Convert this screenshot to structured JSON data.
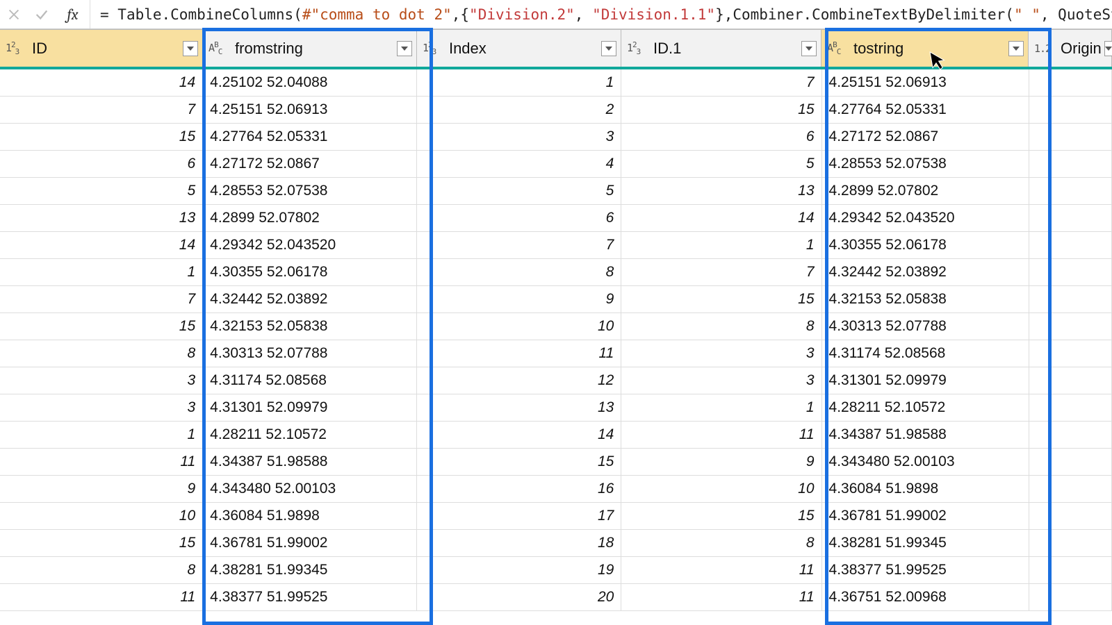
{
  "formula_bar": {
    "fx_label": "fx",
    "formula_prefix": "= ",
    "formula_fn1": "Table.CombineColumns(",
    "formula_str1": "#\"comma to dot 2\"",
    "formula_mid1": ",{",
    "formula_str2a": "\"Division.2\"",
    "formula_mid2": ", ",
    "formula_str2b": "\"Division.1.1\"",
    "formula_mid3": "},Combiner.CombineTextByDelimiter(",
    "formula_str3": "\" \"",
    "formula_tail": ", QuoteSt"
  },
  "columns": [
    {
      "type": "num",
      "icon": "1²₃",
      "name": "ID",
      "width": "w-id",
      "selected": true,
      "align": "num"
    },
    {
      "type": "text",
      "icon": "AᴮC",
      "name": "fromstring",
      "width": "w-from",
      "selected": false,
      "align": "txt",
      "highlighted": true
    },
    {
      "type": "num",
      "icon": "1²₃",
      "name": "Index",
      "width": "w-idx",
      "selected": false,
      "align": "num"
    },
    {
      "type": "num",
      "icon": "1²₃",
      "name": "ID.1",
      "width": "w-id1",
      "selected": false,
      "align": "num"
    },
    {
      "type": "text",
      "icon": "AᴮC",
      "name": "tostring",
      "width": "w-to",
      "selected": true,
      "align": "txt",
      "highlighted": true
    },
    {
      "type": "dec",
      "icon": "1.2",
      "name": "Origin",
      "width": "w-orig",
      "selected": false,
      "align": "num"
    }
  ],
  "rows": [
    {
      "id": "14",
      "from": "4.25102 52.04088",
      "idx": "1",
      "id1": "7",
      "to": "4.25151 52.06913"
    },
    {
      "id": "7",
      "from": "4.25151 52.06913",
      "idx": "2",
      "id1": "15",
      "to": "4.27764 52.05331"
    },
    {
      "id": "15",
      "from": "4.27764 52.05331",
      "idx": "3",
      "id1": "6",
      "to": "4.27172 52.0867"
    },
    {
      "id": "6",
      "from": "4.27172 52.0867",
      "idx": "4",
      "id1": "5",
      "to": "4.28553 52.07538"
    },
    {
      "id": "5",
      "from": "4.28553 52.07538",
      "idx": "5",
      "id1": "13",
      "to": "4.2899 52.07802"
    },
    {
      "id": "13",
      "from": "4.2899 52.07802",
      "idx": "6",
      "id1": "14",
      "to": "4.29342 52.043520"
    },
    {
      "id": "14",
      "from": "4.29342 52.043520",
      "idx": "7",
      "id1": "1",
      "to": "4.30355 52.06178"
    },
    {
      "id": "1",
      "from": "4.30355 52.06178",
      "idx": "8",
      "id1": "7",
      "to": "4.32442 52.03892"
    },
    {
      "id": "7",
      "from": "4.32442 52.03892",
      "idx": "9",
      "id1": "15",
      "to": "4.32153 52.05838"
    },
    {
      "id": "15",
      "from": "4.32153 52.05838",
      "idx": "10",
      "id1": "8",
      "to": "4.30313 52.07788"
    },
    {
      "id": "8",
      "from": "4.30313 52.07788",
      "idx": "11",
      "id1": "3",
      "to": "4.31174 52.08568"
    },
    {
      "id": "3",
      "from": "4.31174 52.08568",
      "idx": "12",
      "id1": "3",
      "to": "4.31301 52.09979"
    },
    {
      "id": "3",
      "from": "4.31301 52.09979",
      "idx": "13",
      "id1": "1",
      "to": "4.28211 52.10572"
    },
    {
      "id": "1",
      "from": "4.28211 52.10572",
      "idx": "14",
      "id1": "11",
      "to": "4.34387 51.98588"
    },
    {
      "id": "11",
      "from": "4.34387 51.98588",
      "idx": "15",
      "id1": "9",
      "to": "4.343480 52.00103"
    },
    {
      "id": "9",
      "from": "4.343480 52.00103",
      "idx": "16",
      "id1": "10",
      "to": "4.36084 51.9898"
    },
    {
      "id": "10",
      "from": "4.36084 51.9898",
      "idx": "17",
      "id1": "15",
      "to": "4.36781 51.99002"
    },
    {
      "id": "15",
      "from": "4.36781 51.99002",
      "idx": "18",
      "id1": "8",
      "to": "4.38281 51.99345"
    },
    {
      "id": "8",
      "from": "4.38281 51.99345",
      "idx": "19",
      "id1": "11",
      "to": "4.38377 51.99525"
    },
    {
      "id": "11",
      "from": "4.38377 51.99525",
      "idx": "20",
      "id1": "11",
      "to": "4.36751 52.00968"
    }
  ]
}
